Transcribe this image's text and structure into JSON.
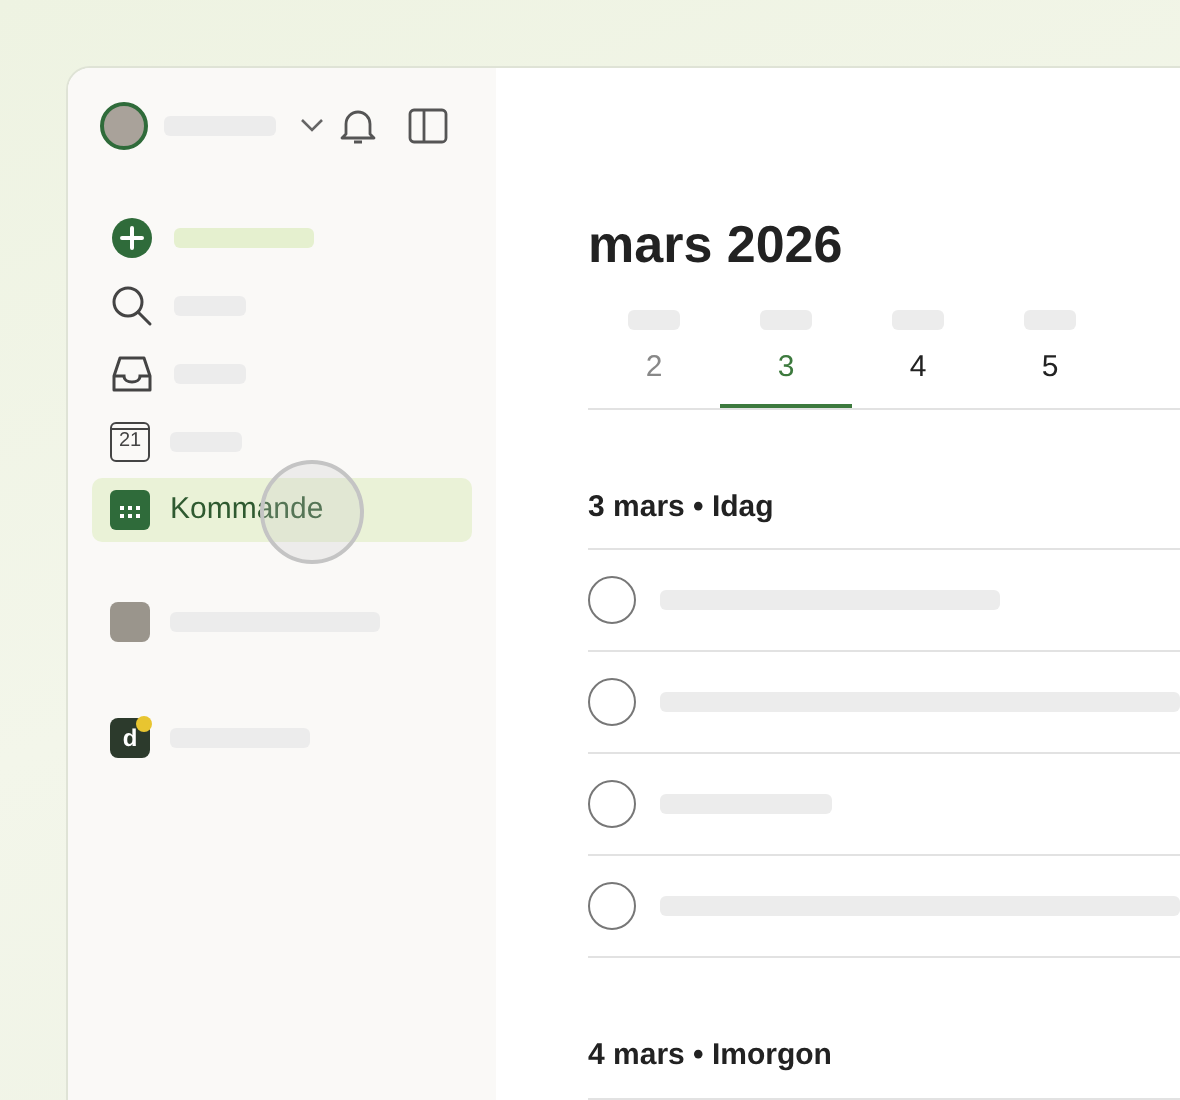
{
  "sidebar": {
    "nav_items": [
      {
        "kind": "add",
        "selected": false
      },
      {
        "kind": "search",
        "selected": false
      },
      {
        "kind": "inbox",
        "selected": false
      },
      {
        "kind": "today",
        "icon_text": "21",
        "selected": false
      },
      {
        "kind": "upcoming",
        "label": "Kommande",
        "selected": true
      }
    ],
    "projects": [
      {
        "kind": "person"
      },
      {
        "kind": "team",
        "letter": "d"
      }
    ]
  },
  "main": {
    "title": "mars 2026",
    "days": [
      {
        "number": "2",
        "selected": false,
        "past": true
      },
      {
        "number": "3",
        "selected": true,
        "past": false
      },
      {
        "number": "4",
        "selected": false,
        "past": false
      },
      {
        "number": "5",
        "selected": false,
        "past": false
      }
    ],
    "sections": [
      {
        "heading": "3 mars • Idag",
        "tasks": [
          {
            "checked": false
          },
          {
            "checked": false
          },
          {
            "checked": false
          },
          {
            "checked": false
          }
        ]
      },
      {
        "heading": "4 mars • Imorgon"
      }
    ]
  }
}
